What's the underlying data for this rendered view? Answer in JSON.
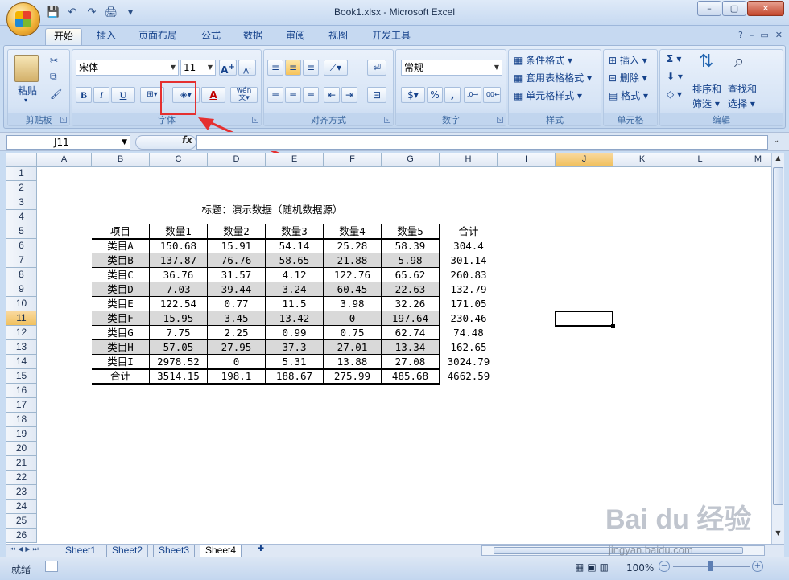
{
  "window": {
    "title": "Book1.xlsx - Microsoft Excel",
    "min": "–",
    "max": "▢",
    "close": "✕"
  },
  "qat": {
    "save": "💾",
    "undo": "↶",
    "redo": "↷",
    "print": "🖨",
    "more": "▾"
  },
  "tabs": [
    "开始",
    "插入",
    "页面布局",
    "公式",
    "数据",
    "审阅",
    "视图",
    "开发工具"
  ],
  "ribbon": {
    "clipboard": {
      "label": "剪贴板",
      "paste": "粘贴"
    },
    "font": {
      "label": "字体",
      "font_name": "宋体",
      "font_size": "11",
      "bold": "B",
      "italic": "I",
      "underline": "U",
      "font_color": "A",
      "phonetic": "wén"
    },
    "alignment": {
      "label": "对齐方式"
    },
    "number": {
      "label": "数字",
      "format": "常规",
      "percent": "%",
      "comma": ","
    },
    "styles": {
      "label": "样式",
      "conditional": "条件格式",
      "table": "套用表格格式",
      "cell_styles": "单元格样式"
    },
    "cells": {
      "label": "单元格",
      "insert": "插入",
      "delete": "删除",
      "format": "格式"
    },
    "editing": {
      "label": "编辑",
      "sum": "Σ",
      "sort_filter_1": "排序和",
      "sort_filter_2": "筛选",
      "find_select_1": "查找和",
      "find_select_2": "选择"
    }
  },
  "formula_bar": {
    "name_box": "J11",
    "fx": "fx",
    "value": ""
  },
  "columns": [
    "A",
    "B",
    "C",
    "D",
    "E",
    "F",
    "G",
    "H",
    "I",
    "J",
    "K",
    "L",
    "M"
  ],
  "selected_column": "J",
  "rows": [
    "1",
    "2",
    "3",
    "4",
    "5",
    "6",
    "7",
    "8",
    "9",
    "10",
    "11",
    "12",
    "13",
    "14",
    "15",
    "16",
    "17",
    "18",
    "19",
    "20",
    "21",
    "22",
    "23",
    "24",
    "25",
    "26"
  ],
  "selected_row": "11",
  "sheet": {
    "title": "标题：演示数据（随机数据源）",
    "headers": [
      "项目",
      "数量1",
      "数量2",
      "数量3",
      "数量4",
      "数量5",
      "合计"
    ],
    "data": [
      [
        "类目A",
        "150.68",
        "15.91",
        "54.14",
        "25.28",
        "58.39",
        "304.4"
      ],
      [
        "类目B",
        "137.87",
        "76.76",
        "58.65",
        "21.88",
        "5.98",
        "301.14"
      ],
      [
        "类目C",
        "36.76",
        "31.57",
        "4.12",
        "122.76",
        "65.62",
        "260.83"
      ],
      [
        "类目D",
        "7.03",
        "39.44",
        "3.24",
        "60.45",
        "22.63",
        "132.79"
      ],
      [
        "类目E",
        "122.54",
        "0.77",
        "11.5",
        "3.98",
        "32.26",
        "171.05"
      ],
      [
        "类目F",
        "15.95",
        "3.45",
        "13.42",
        "0",
        "197.64",
        "230.46"
      ],
      [
        "类目G",
        "7.75",
        "2.25",
        "0.99",
        "0.75",
        "62.74",
        "74.48"
      ],
      [
        "类目H",
        "57.05",
        "27.95",
        "37.3",
        "27.01",
        "13.34",
        "162.65"
      ],
      [
        "类目I",
        "2978.52",
        "0",
        "5.31",
        "13.88",
        "27.08",
        "3024.79"
      ]
    ],
    "total": [
      "合计",
      "3514.15",
      "198.1",
      "188.67",
      "275.99",
      "485.68",
      "4662.59"
    ]
  },
  "sheet_tabs": [
    "Sheet1",
    "Sheet2",
    "Sheet3",
    "Sheet4"
  ],
  "active_sheet": "Sheet4",
  "status": {
    "ready": "就绪",
    "zoom": "100%"
  },
  "watermark": {
    "logo": "Bai du 经验",
    "url": "jingyan.baidu.com"
  },
  "colors": {
    "highlight_box": "#e53030",
    "arrow": "#e53030",
    "stripe": "#d9d9d9"
  }
}
